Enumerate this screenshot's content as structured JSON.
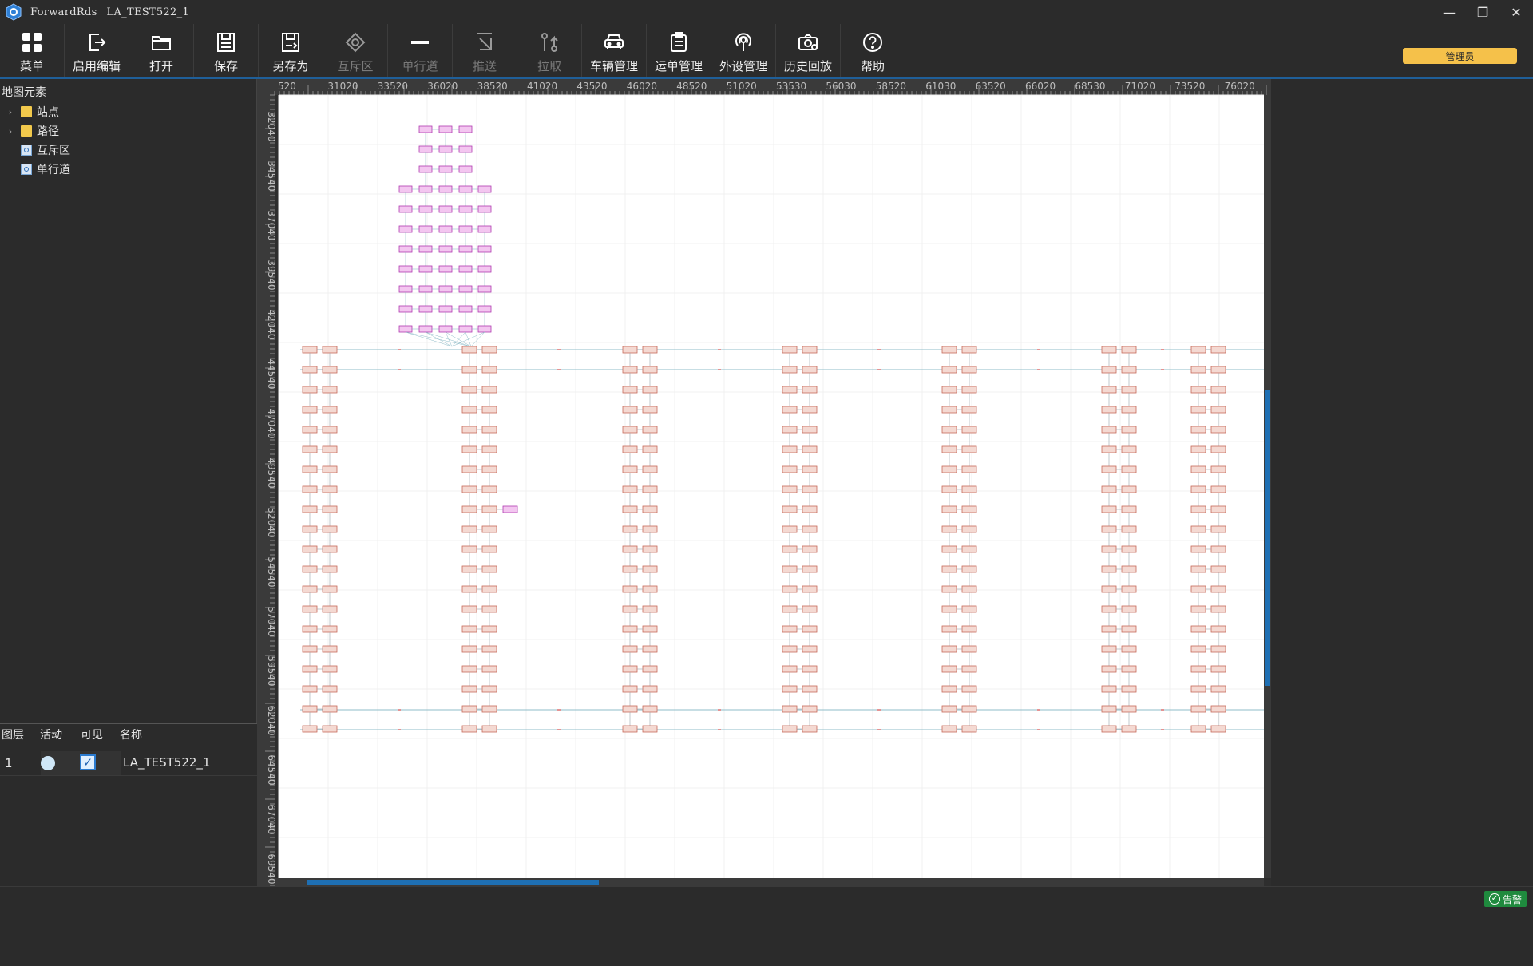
{
  "window": {
    "app_name": "ForwardRds",
    "document": "LA_TEST522_1",
    "minimize": "—",
    "restore": "❐",
    "close": "✕"
  },
  "toolbar": {
    "items": [
      {
        "label": "菜单",
        "icon": "grid-icon",
        "enabled": true
      },
      {
        "label": "启用编辑",
        "icon": "edit-export-icon",
        "enabled": true
      },
      {
        "label": "打开",
        "icon": "folder-open-icon",
        "enabled": true
      },
      {
        "label": "保存",
        "icon": "save-icon",
        "enabled": true
      },
      {
        "label": "另存为",
        "icon": "save-as-icon",
        "enabled": true
      },
      {
        "label": "互斥区",
        "icon": "exclusion-zone-icon",
        "enabled": false
      },
      {
        "label": "单行道",
        "icon": "one-way-icon",
        "enabled": false
      },
      {
        "label": "推送",
        "icon": "push-icon",
        "enabled": false
      },
      {
        "label": "拉取",
        "icon": "pull-icon",
        "enabled": false
      },
      {
        "label": "车辆管理",
        "icon": "vehicle-icon",
        "enabled": true
      },
      {
        "label": "运单管理",
        "icon": "waybill-icon",
        "enabled": true
      },
      {
        "label": "外设管理",
        "icon": "peripheral-icon",
        "enabled": true
      },
      {
        "label": "历史回放",
        "icon": "history-replay-icon",
        "enabled": true
      },
      {
        "label": "帮助",
        "icon": "help-icon",
        "enabled": true
      }
    ],
    "user_role": "管理员"
  },
  "tree": {
    "title": "地图元素",
    "items": [
      {
        "label": "站点",
        "type": "folder",
        "expandable": true
      },
      {
        "label": "路径",
        "type": "folder",
        "expandable": true
      },
      {
        "label": "互斥区",
        "type": "node",
        "expandable": false
      },
      {
        "label": "单行道",
        "type": "node",
        "expandable": false
      }
    ]
  },
  "layers": {
    "headers": [
      "图层",
      "活动",
      "可见",
      "名称"
    ],
    "rows": [
      {
        "index": "1",
        "active": true,
        "visible": true,
        "name": "LA_TEST522_1"
      }
    ]
  },
  "ruler": {
    "top": [
      "520",
      "31020",
      "33520",
      "36020",
      "38520",
      "41020",
      "43520",
      "46020",
      "48520",
      "51020",
      "53530",
      "56030",
      "58520",
      "61030",
      "63520",
      "66020",
      "68530",
      "71020",
      "73520",
      "76020"
    ],
    "left": [
      "-32040",
      "-34540",
      "-37040",
      "-39540",
      "-42040",
      "-44540",
      "-47040",
      "-49540",
      "-52040",
      "-54540",
      "-57040",
      "-59540",
      "-62040",
      "-64540",
      "-67040",
      "-69540"
    ]
  },
  "map": {
    "station_color": "#f4d9d2",
    "station_border": "#c76a5a",
    "pink_color": "#f3c6f0",
    "pink_border": "#b03bb0",
    "path_color": "#8fbcc8"
  },
  "status": {
    "alarm_label": "告警"
  }
}
